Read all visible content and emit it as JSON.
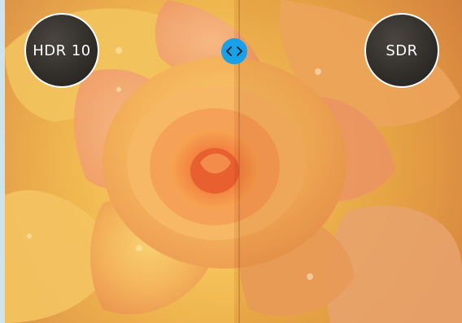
{
  "labels": {
    "left_mode": "HDR 10",
    "right_mode": "SDR"
  },
  "slider": {
    "icon": "left-right-arrows-icon",
    "accent_color": "#18a0e8"
  },
  "image": {
    "subject": "rose-photo"
  }
}
